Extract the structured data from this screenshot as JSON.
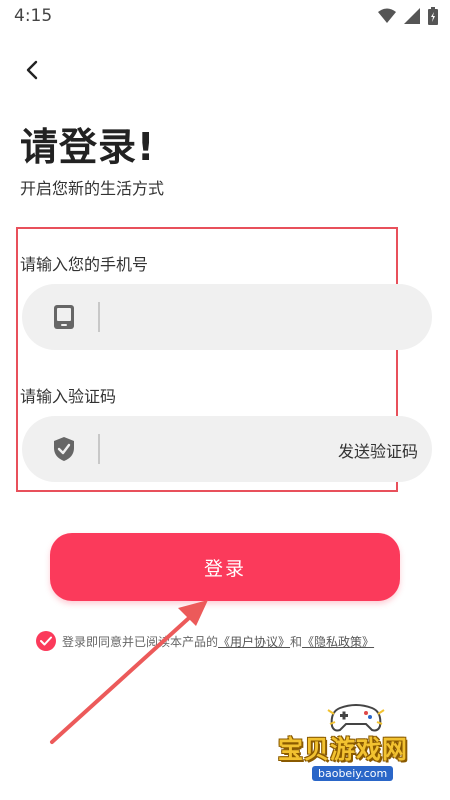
{
  "status_bar": {
    "time": "4:15"
  },
  "header": {
    "title": "请登录!",
    "subtitle": "开启您新的生活方式"
  },
  "phone_field": {
    "label": "请输入您的手机号",
    "value": "",
    "placeholder": ""
  },
  "code_field": {
    "label": "请输入验证码",
    "value": "",
    "placeholder": "",
    "send_code_label": "发送验证码"
  },
  "login_button": {
    "label": "登录"
  },
  "agreement": {
    "checked": true,
    "prefix": "登录即同意并已阅读本产品的",
    "user_agreement": "《用户协议》",
    "conjunction": "和",
    "privacy_policy": "《隐私政策》"
  },
  "watermark": {
    "name": "宝贝游戏网",
    "url": "baobeiy.com"
  },
  "colors": {
    "accent": "#fb3a5b",
    "highlight_border": "#e8505b",
    "field_bg": "#f0f0f0"
  },
  "icons": [
    "back-arrow-icon",
    "phone-icon",
    "shield-check-icon",
    "checkmark-icon",
    "wifi-icon",
    "signal-icon",
    "battery-icon"
  ]
}
